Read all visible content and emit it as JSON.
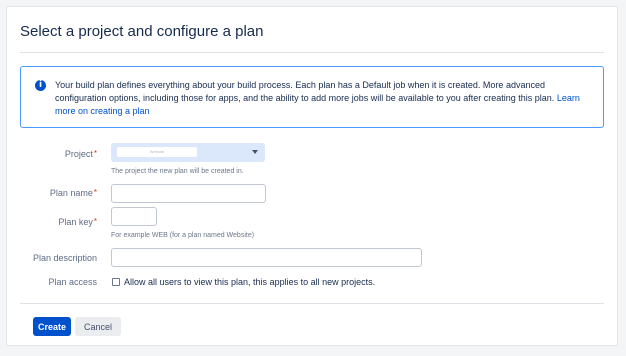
{
  "page": {
    "title": "Select a project and configure a plan"
  },
  "info": {
    "text": "Your build plan defines everything about your build process. Each plan has a Default job when it is created. More advanced configuration options, including those for apps, and the ability to add more jobs will be available to you after creating this plan. ",
    "link_label": "Learn more on creating a plan"
  },
  "form": {
    "project": {
      "label": "Project",
      "required_mark": "*",
      "value": "Website",
      "help": "The project the new plan will be created in."
    },
    "plan_name": {
      "label": "Plan name",
      "required_mark": "*",
      "value": ""
    },
    "plan_key": {
      "label": "Plan key",
      "required_mark": "*",
      "value": "",
      "help": "For example WEB (for a plan named Website)"
    },
    "plan_description": {
      "label": "Plan description",
      "value": ""
    },
    "plan_access": {
      "label": "Plan access",
      "checkbox_label": "Allow all users to view this plan, this applies to all new projects.",
      "checked": false
    }
  },
  "actions": {
    "create_label": "Create",
    "cancel_label": "Cancel"
  },
  "colors": {
    "primary": "#0052cc",
    "info_border": "#4c9aff",
    "select_bg": "#dbe7fb",
    "required": "#de350b"
  },
  "icons": {
    "info": "info-icon",
    "dropdown": "chevron-down-icon"
  }
}
